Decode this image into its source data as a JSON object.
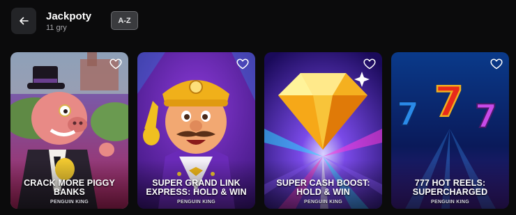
{
  "header": {
    "title": "Jackpoty",
    "count": "11 gry",
    "sort_label": "A-Z",
    "back_icon": "arrow-left-icon"
  },
  "games": [
    {
      "title": "CRACK MORE PIGGY BANKS",
      "provider": "PENGUIN KING",
      "fav_icon": "heart-outline-icon"
    },
    {
      "title": "SUPER GRAND LINK EXPRESS: HOLD & WIN",
      "provider": "PENGUIN KING",
      "fav_icon": "heart-outline-icon"
    },
    {
      "title": "SUPER CASH BOOST: HOLD & WIN",
      "provider": "PENGUIN KING",
      "fav_icon": "heart-outline-icon"
    },
    {
      "title": "777 HOT REELS: SUPERCHARGED",
      "provider": "PENGUIN KING",
      "fav_icon": "heart-outline-icon"
    }
  ],
  "colors": {
    "background": "#0b0b0c",
    "control_bg": "#232427",
    "sort_bg": "#3a3b3e"
  }
}
